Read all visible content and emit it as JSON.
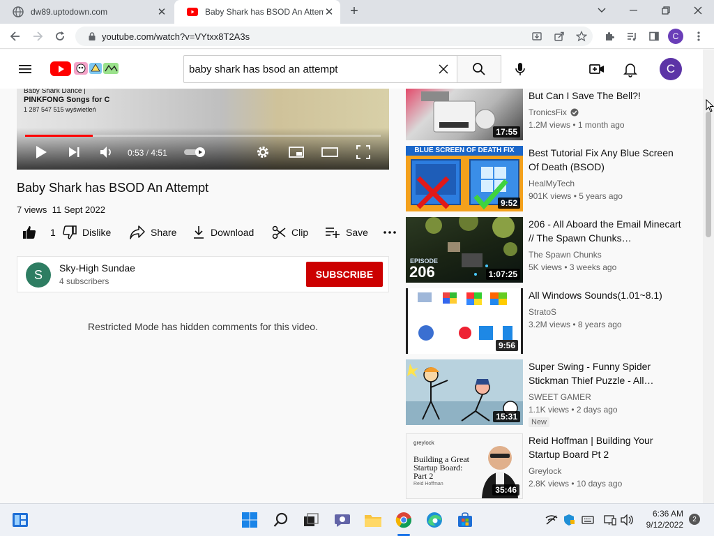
{
  "browser": {
    "tabs": [
      {
        "title": "dw89.uptodown.com",
        "active": false
      },
      {
        "title": "Baby Shark has BSOD An Attempt",
        "active": true
      }
    ],
    "url": "youtube.com/watch?v=VYtxx8T2A3s"
  },
  "youtube": {
    "search": {
      "query": "baby shark has bsod an attempt"
    },
    "account_initial": "C"
  },
  "player": {
    "current_time": "0:53",
    "separator": "/",
    "duration": "4:51",
    "progress": 0.19,
    "overlay_lines": [
      "Baby Shark Dance |",
      "PINKFONG Songs for C",
      "1 287 547 515 wyświetleń"
    ]
  },
  "video": {
    "title": "Baby Shark has BSOD An Attempt",
    "views": "7 views",
    "date": "11 Sept 2022",
    "like_count": "1",
    "actions": {
      "dislike": "Dislike",
      "share": "Share",
      "download": "Download",
      "clip": "Clip",
      "save": "Save"
    }
  },
  "channel": {
    "initial": "S",
    "name": "Sky-High Sundae",
    "subscribers": "4 subscribers",
    "subscribe_label": "SUBSCRIBE"
  },
  "comments": {
    "restricted_message": "Restricted Mode has hidden comments for this video."
  },
  "recommendations": [
    {
      "title": "But Can I Save The Bell?!",
      "channel": "TronicsFix",
      "verified": true,
      "meta": "1.2M views • 1 month ago",
      "duration": "17:55"
    },
    {
      "title": "Best Tutorial Fix Any Blue Screen Of Death (BSOD)",
      "channel": "HealMyTech",
      "meta": "901K views • 5 years ago",
      "duration": "9:52",
      "thumb_text": "BLUE SCREEN OF DEATH FIX"
    },
    {
      "title": "206 - All Aboard the Email Minecart // The Spawn Chunks…",
      "channel": "The Spawn Chunks",
      "meta": "5K views • 3 weeks ago",
      "duration": "1:07:25",
      "thumb_text": "EPISODE",
      "thumb_number": "206"
    },
    {
      "title": "All Windows Sounds(1.01~8.1)",
      "channel": "StratoS",
      "meta": "3.2M views • 8 years ago",
      "duration": "9:56"
    },
    {
      "title": "Super Swing - Funny Spider Stickman Thief Puzzle - All…",
      "channel": "SWEET GAMER",
      "meta": "1.1K views • 2 days ago",
      "duration": "15:31",
      "badge": "New"
    },
    {
      "title": "Reid Hoffman | Building Your Startup Board Pt 2",
      "channel": "Greylock",
      "meta": "2.8K views • 10 days ago",
      "duration": "35:46",
      "thumb_brand": "greylock",
      "thumb_text": "Building a Great Startup Board: Part 2",
      "thumb_author": "Reid Hoffman"
    }
  ],
  "taskbar": {
    "time": "6:36 AM",
    "date": "9/12/2022",
    "notifications": "2"
  },
  "colors": {
    "youtube_red": "#ff0000",
    "subscribe_red": "#cc0000",
    "avatar_purple": "#5c34a6",
    "channel_green": "#2e7d62"
  }
}
